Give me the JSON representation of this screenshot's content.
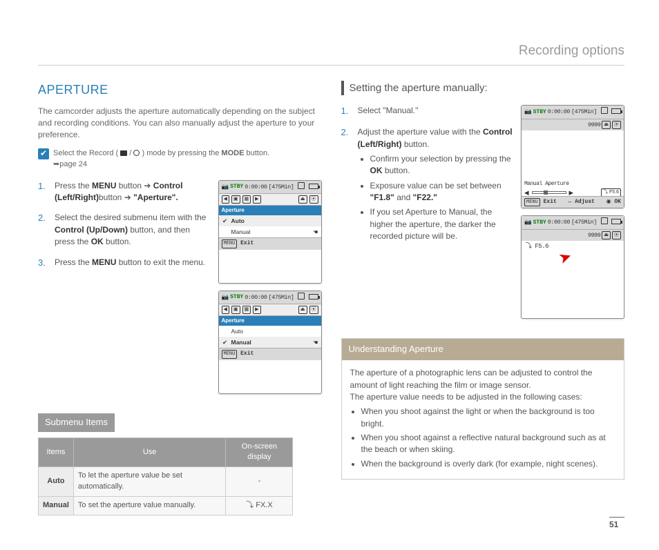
{
  "header": {
    "title": "Recording options"
  },
  "page_number": "51",
  "left": {
    "title": "APERTURE",
    "intro": "The camcorder adjusts the aperture automatically depending on the subject and recording conditions. You can also manually adjust the aperture to your preference.",
    "note_prefix": "Select the Record (",
    "note_mid": " / ",
    "note_suffix": ") mode by pressing the ",
    "note_bold": "MODE",
    "note_end": " button.",
    "note_page": "➥page 24",
    "steps": {
      "s1a": "Press the ",
      "s1b": "MENU",
      "s1c": " button ",
      "s1arrow": "➔",
      "s1d": " Control (Left/Right)",
      "s1e": "button ",
      "s1f": "➔",
      "s1g": " \"Aperture\".",
      "s2a": "Select the desired submenu item with the ",
      "s2b": "Control (Up/Down)",
      "s2c": " button, and then press the ",
      "s2d": "OK",
      "s2e": " button.",
      "s3a": "Press the ",
      "s3b": "MENU",
      "s3c": " button to exit the menu."
    },
    "lcd": {
      "stby": "STBY",
      "time": "0:00:00",
      "remain": "[475Min]",
      "menu_title": "Aperture",
      "auto": "Auto",
      "manual": "Manual",
      "exit_label": "Exit",
      "menu_tag": "MENU"
    },
    "submenu_label": "Submenu Items",
    "table": {
      "h1": "Items",
      "h2": "Use",
      "h3": "On-screen display",
      "r1c1": "Auto",
      "r1c2": "To let the aperture value be set automatically.",
      "r1c3": "-",
      "r2c1": "Manual",
      "r2c2": "To set the aperture value manually.",
      "r2c3": "FX.X",
      "r2c3_icon": "⤵"
    }
  },
  "right": {
    "subtitle": "Setting the aperture manually:",
    "s1": "Select \"Manual.\"",
    "s2a": "Adjust the aperture value with the ",
    "s2b": "Control (Left/Right)",
    "s2c": " button.",
    "b1a": "Confirm your selection by pressing the ",
    "b1b": "OK",
    "b1c": " button.",
    "b2a": "Exposure value can be set between ",
    "b2b": "\"F1.8\"",
    "b2c": " and ",
    "b2d": "\"F22.\"",
    "b3": "If you set Aperture to Manual, the higher the aperture, the darker the recorded picture will be.",
    "lcd": {
      "stby": "STBY",
      "time": "0:00:00",
      "remain": "[475Min]",
      "count": "9999",
      "ma": "Manual Aperture",
      "fval": "F5.6",
      "exit": "Exit",
      "adjust": "Adjust",
      "ok": "OK",
      "menu": "MENU",
      "f2": "F5.6"
    },
    "info": {
      "title": "Understanding Aperture",
      "p1": "The aperture of a photographic lens can be adjusted to control the amount of light reaching the film or image sensor.",
      "p2": "The aperture value needs to be adjusted in the following cases:",
      "li1": "When you shoot against the light or when the background is too bright.",
      "li2": "When you shoot against a reflective natural background such as at the beach or when skiing.",
      "li3": "When the background is overly dark (for example, night scenes)."
    }
  }
}
